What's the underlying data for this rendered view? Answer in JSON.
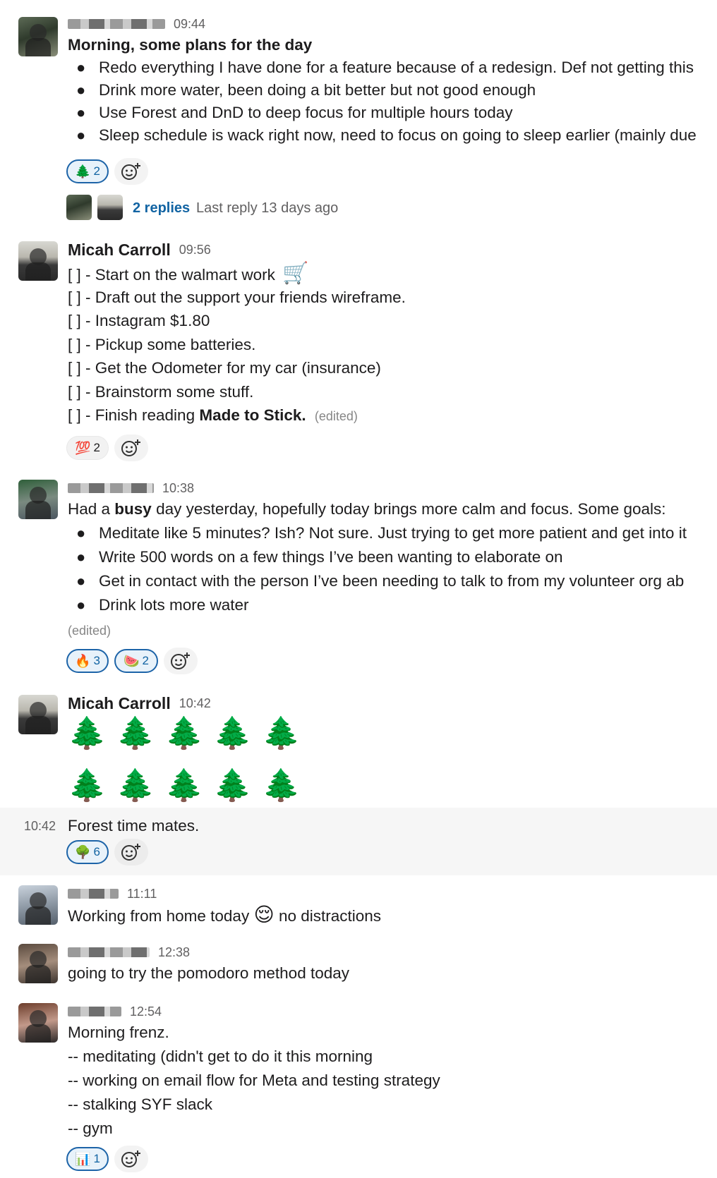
{
  "messages": [
    {
      "time": "09:44",
      "title": "Morning, some plans for the day",
      "bullets": [
        "Redo everything I have done for a feature because of a redesign. Def not getting this",
        "Drink more water, been doing a bit better but not good enough",
        "Use Forest and DnD to deep focus for multiple hours today",
        "Sleep schedule is wack right now, need to focus on going to sleep earlier (mainly due"
      ],
      "reactions": [
        {
          "emoji": "🌲",
          "count": "2"
        }
      ],
      "thread": {
        "replies": "2 replies",
        "last": "Last reply 13 days ago"
      }
    },
    {
      "name": "Micah Carroll",
      "time": "09:56",
      "lines": [
        "[ ] - Start on the walmart work",
        "[ ] - Draft out the support your friends wireframe.",
        "[ ] - Instagram $1.80",
        "[ ] - Pickup some batteries.",
        "[ ] - Get the Odometer for my car (insurance)",
        "[ ] - Brainstorm some stuff.",
        "[ ] - Finish reading "
      ],
      "cart_emoji": "🛒",
      "bold_book": "Made to Stick.",
      "edited": "(edited)",
      "reactions": [
        {
          "emoji": "💯",
          "count": "2"
        }
      ]
    },
    {
      "time": "10:38",
      "intro_a": "Had a ",
      "intro_bold": "busy",
      "intro_b": " day yesterday, hopefully today brings more calm and focus. Some goals:",
      "bullets": [
        "Meditate like 5 minutes? Ish? Not sure. Just trying to get more patient and get into it",
        "Write 500 words on a few things I’ve been wanting to elaborate on",
        "Get in contact with the person I’ve been needing to talk to from my volunteer org ab",
        "Drink lots more water"
      ],
      "edited": "(edited)",
      "reactions": [
        {
          "emoji": "🔥",
          "count": "3"
        },
        {
          "emoji": "🍉",
          "count": "2"
        }
      ]
    },
    {
      "name": "Micah Carroll",
      "time": "10:42",
      "trees_row1": "🌲🌲🌲🌲🌲",
      "trees_row2": "🌲🌲🌲🌲🌲",
      "cont_time": "10:42",
      "cont_text": "Forest time mates.",
      "reactions": [
        {
          "emoji": "🌳",
          "count": "6"
        }
      ]
    },
    {
      "time": "11:11",
      "text_a": "Working from home today",
      "emoji": "😌",
      "text_b": "no distractions"
    },
    {
      "time": "12:38",
      "text": "going to try the pomodoro method today"
    },
    {
      "time": "12:54",
      "lines": [
        "Morning frenz.",
        "-- meditating (didn't get to do it this morning",
        "-- working on email flow for Meta and testing strategy",
        "-- stalking SYF slack",
        "-- gym"
      ],
      "reactions": [
        {
          "emoji": "📊",
          "count": "1"
        }
      ]
    }
  ],
  "icons": {
    "add_reaction": "add-reaction-icon"
  },
  "colors": {
    "link": "#1264a3",
    "reaction_border": "#1d64a8",
    "reaction_bg": "#e8f2fa",
    "hover_bg": "#f6f6f6"
  }
}
